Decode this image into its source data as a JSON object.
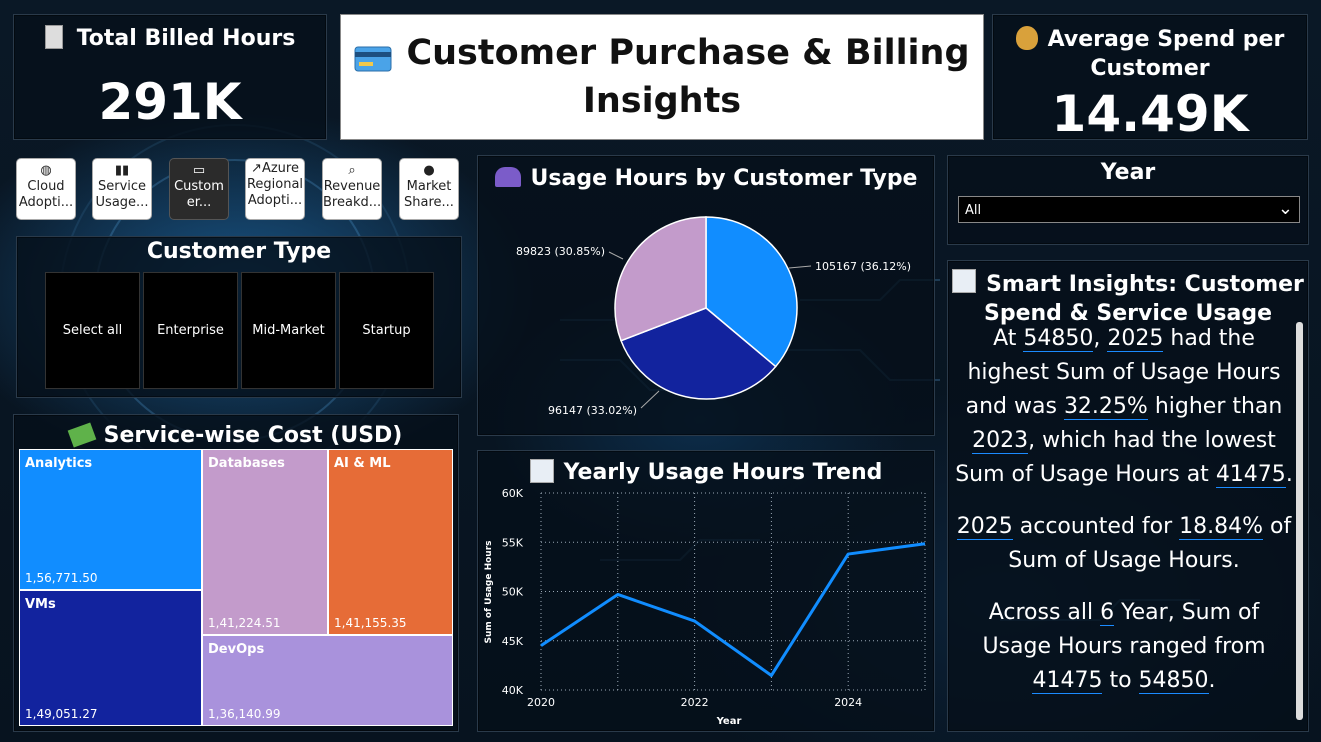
{
  "kpi_billed": {
    "title": "Total Billed Hours",
    "value": "291K"
  },
  "title_card": {
    "line1": "Customer Purchase & Billing",
    "line2": "Insights"
  },
  "kpi_spend": {
    "title_line1": "Average Spend per",
    "title_line2": "Customer",
    "value": "14.49K"
  },
  "nav": [
    {
      "icon": "globe-icon",
      "label1": "Cloud",
      "label2": "Adopti..."
    },
    {
      "icon": "bar-chart-icon",
      "label1": "Service",
      "label2": "Usage..."
    },
    {
      "icon": "credit-card-icon",
      "label1": "Custom",
      "label2": "er..."
    },
    {
      "icon": "line-chart-icon",
      "label1": "Azure",
      "label2": "Regional",
      "label3": "Adopti..."
    },
    {
      "icon": "magnifier-icon",
      "label1": "Revenue",
      "label2": "Breakd..."
    },
    {
      "icon": "earth-icon",
      "label1": "Market",
      "label2": "Share..."
    }
  ],
  "customer_type": {
    "title": "Customer Type",
    "options": [
      "Select all",
      "Enterprise",
      "Mid-Market",
      "Startup"
    ]
  },
  "service_cost": {
    "title": "Service-wise Cost (USD)",
    "items": [
      {
        "name": "Analytics",
        "value": "1,56,771.50",
        "color": "#118DFF"
      },
      {
        "name": "VMs",
        "value": "1,49,051.27",
        "color": "#12239E"
      },
      {
        "name": "Databases",
        "value": "1,41,224.51",
        "color": "#C39BCB"
      },
      {
        "name": "AI & ML",
        "value": "1,41,155.35",
        "color": "#E66C37"
      },
      {
        "name": "DevOps",
        "value": "1,36,140.99",
        "color": "#A992DC"
      }
    ]
  },
  "pie": {
    "title": "Usage Hours by Customer Type",
    "labels": [
      "105167 (36.12%)",
      "96147 (33.02%)",
      "89823 (30.85%)"
    ]
  },
  "trend": {
    "title": "Yearly Usage Hours Trend",
    "xlabel": "Year",
    "ylabel": "Sum of Usage Hours",
    "yticks": [
      "60K",
      "55K",
      "50K",
      "45K",
      "40K"
    ],
    "xticks": [
      "2020",
      "2022",
      "2024"
    ]
  },
  "year_filter": {
    "title": "Year",
    "selected": "All"
  },
  "insights": {
    "title_line1": "Smart Insights: Customer",
    "title_line2": "Spend & Service Usage",
    "p1": {
      "a": "At ",
      "v1": "54850",
      "b": ", ",
      "v2": "2025",
      "c": " had the highest Sum of Usage Hours and was ",
      "v3": "32.25%",
      "d": " higher than ",
      "v4": "2023",
      "e": ", which had the lowest Sum of Usage Hours at ",
      "v5": "41475",
      "f": "."
    },
    "p2": {
      "v1": "2025",
      "a": " accounted for ",
      "v2": "18.84%",
      "b": " of Sum of Usage Hours."
    },
    "p3": {
      "a": "Across all ",
      "v1": "6",
      "b": " Year, Sum of Usage Hours ranged from ",
      "v2": "41475",
      "c": " to ",
      "v3": "54850",
      "d": "."
    }
  },
  "chart_data": [
    {
      "type": "pie",
      "title": "Usage Hours by Customer Type",
      "categories": [
        "Enterprise",
        "Mid-Market",
        "Startup"
      ],
      "values": [
        105167,
        96147,
        89823
      ],
      "colors": [
        "#118DFF",
        "#12239E",
        "#C39BCB"
      ]
    },
    {
      "type": "line",
      "title": "Yearly Usage Hours Trend",
      "xlabel": "Year",
      "ylabel": "Sum of Usage Hours",
      "x": [
        2020,
        2021,
        2022,
        2023,
        2024,
        2025
      ],
      "series": [
        {
          "values": [
            44500,
            49700,
            47000,
            41475,
            53800,
            54850
          ]
        }
      ],
      "xlim": [
        2020,
        2025
      ],
      "ylim": [
        40000,
        60000
      ],
      "grid": true,
      "color": "#118DFF"
    },
    {
      "type": "treemap",
      "title": "Service-wise Cost (USD)",
      "categories": [
        "Analytics",
        "VMs",
        "Databases",
        "AI & ML",
        "DevOps"
      ],
      "values": [
        156771.5,
        149051.27,
        141224.51,
        141155.35,
        136140.99
      ]
    }
  ]
}
